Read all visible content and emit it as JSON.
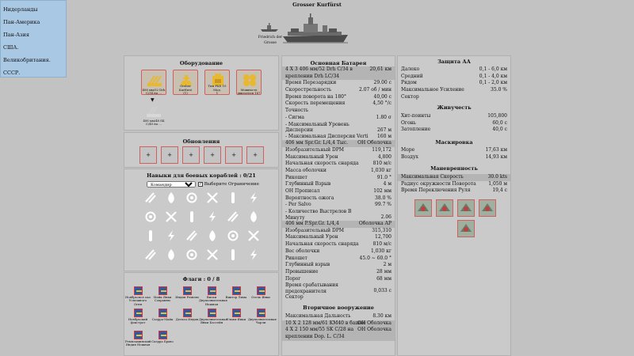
{
  "nav": [
    "Нидерланды",
    "Пан-Америка",
    "Пан-Азия",
    "США.",
    "Великобритания.",
    "СССР."
  ],
  "ship": {
    "title": "Grosser Kurfürst",
    "small_line1": "Friedrich der",
    "small_line2": "Grosse"
  },
  "equipment": {
    "title": "Оборудование",
    "items": [
      {
        "label1": "406 мм/52 Drh",
        "label2": "C/34 на ...",
        "icon": "turret-icon"
      },
      {
        "label1": "Grober Kurfürst",
        "label2": "(1)",
        "icon": "hull-icon"
      },
      {
        "label1": "Тип FKS 10 Мод.",
        "label2": "1",
        "icon": "fire-control-icon"
      },
      {
        "label1": "Мощность",
        "label2": "двигателя 167",
        "icon": "engine-icon"
      }
    ],
    "arrow": "▼",
    "secondary": {
      "label1": "406 мм/48 SK",
      "label2": "C/40 на ..."
    }
  },
  "upgrades": {
    "title": "Обновления",
    "slots": [
      "+",
      "+",
      "+",
      "+",
      "+",
      "+"
    ]
  },
  "skills": {
    "title": "Навыки для боевых кораблей : 0/21",
    "commander": "Командир",
    "checkbox_label": "Выберите Ограничение",
    "checked": true,
    "icons": [
      [
        "guns-icon",
        "flame-icon",
        "flame-icon",
        "wrench-icon",
        "torpedo-icon",
        "lightning-icon"
      ],
      [
        "fire-icon",
        "spotting-icon",
        "fire-drop-icon",
        "crossed-wrenches-icon",
        "telescope-icon",
        "shell-icon"
      ],
      [
        "crossed-guns-icon",
        "explosion-icon",
        "target-icon",
        "cross-icon",
        "wrench-icon",
        "anchor-icon"
      ],
      [
        "spanner-icon",
        "eye-icon",
        "propeller-icon",
        "repair-icon",
        "tower-icon",
        "hammer-icon"
      ]
    ]
  },
  "flags": {
    "title": "Флаги : 0 / 8",
    "items": [
      "Ноябрьское око Успешного Огня",
      "Майк Янки Сохраняю",
      "Индия Ремпли",
      "Виски Двуполнительная Нежная",
      "Виктор Лима",
      "Отель Янки",
      "Ноябрьский фокстрот",
      "Сьерра-Майк",
      "Дельта Индия",
      "Двуполнительная Янки Бассейн",
      "Ульям-Янки",
      "Двуполнительная Чарли",
      "Ремпламинский Индия Нежная",
      "Сьерра Браво"
    ]
  },
  "main_battery": {
    "title": "Основная Батарея",
    "rows": [
      {
        "k": "4 X 3 406 мм/52 Drh C/34 в",
        "v": "20,61 км",
        "sh": true
      },
      {
        "k": "креплении Drh LC/34",
        "v": "",
        "sh": true
      },
      {
        "k": "Время Перезарядки",
        "v": "29.00 с"
      },
      {
        "k": "Скорострельность",
        "v": "2.07 об / мин"
      },
      {
        "k": "Время поворота на 180°",
        "v": "40,00 с"
      },
      {
        "k": "Скорость перемещения",
        "v": "4,50 °/с"
      },
      {
        "k": "Точность",
        "v": ""
      },
      {
        "k": " - Сигма",
        "v": "1.80 σ"
      },
      {
        "k": " - Максимальный Уровень Дисперсии",
        "v": "267 м",
        "tall": true
      },
      {
        "k": " - Максимальная Дисперсия Verti",
        "v": "160 м"
      },
      {
        "k": "406 мм Spr.Gr. L/4,4 Тыс.",
        "v": "ОН Оболочка",
        "sh": true
      },
      {
        "k": "Изобразительный DPM",
        "v": "119,172"
      },
      {
        "k": "Максимальный Урон",
        "v": "4,800"
      },
      {
        "k": "Начальная скорость снаряда",
        "v": "810 м/с"
      },
      {
        "k": "Масса оболочки",
        "v": "1,030 кг"
      },
      {
        "k": "Рикошет",
        "v": "91.0 °"
      },
      {
        "k": "Глубинный Взрыв",
        "v": "4 м"
      },
      {
        "k": "ОН Прописал",
        "v": "102 мм"
      },
      {
        "k": "Вероятность ожога",
        "v": "38.0 %"
      },
      {
        "k": " - Per Salvo",
        "v": "99.7 %"
      },
      {
        "k": " - Количество Выстрелов В Минуту",
        "v": "2.06",
        "tall": true
      },
      {
        "k": "406 мм P.Spr.Gr. L/4,4",
        "v": "Оболочка AP",
        "sh": true
      },
      {
        "k": "Изобразительный DPM",
        "v": "315,310"
      },
      {
        "k": "Максимальный Урон",
        "v": "12,700"
      },
      {
        "k": "Начальная скорость снаряда",
        "v": "810 м/с"
      },
      {
        "k": "Вес оболочки",
        "v": "1,030 кг"
      },
      {
        "k": "Рикошет",
        "v": "45.0 ~ 60.0 °"
      },
      {
        "k": "Глубинный взрыв",
        "v": "2 м"
      },
      {
        "k": "Превышение",
        "v": "28 мм"
      },
      {
        "k": "Порог",
        "v": "68 мм"
      },
      {
        "k": "Время срабатывания предохранителя",
        "v": "0,033 с",
        "tall": true
      },
      {
        "k": "Сектор",
        "v": ""
      }
    ]
  },
  "secondary": {
    "title": "Вторичное вооружение",
    "rows": [
      {
        "k": "Максимальная Дальность",
        "v": "8.30 км"
      },
      {
        "k": "10 X 2 128 мм/61 KM40 в башне",
        "v": "ОН Оболочка",
        "sh": true
      },
      {
        "k": "4 X 2 150 мм/55 SK C/28 на",
        "v": "ОН Оболочка",
        "sh": true
      },
      {
        "k": "креплении Dop. L. C/34",
        "v": "",
        "sh": true
      }
    ]
  },
  "aa": {
    "title": "Защита АА",
    "rows": [
      {
        "k": "Далеко",
        "v": "0,1 - 6,0 км"
      },
      {
        "k": "Средний",
        "v": "0,1 - 4,0 км"
      },
      {
        "k": "Рядом",
        "v": "0,1 - 2,0 км"
      },
      {
        "k": "Максимальное Усиление",
        "v": "35.0 %"
      },
      {
        "k": "Сектор",
        "v": ""
      }
    ]
  },
  "survival": {
    "title": "Живучесть",
    "rows": [
      {
        "k": "Хит-поинты",
        "v": "105,800"
      },
      {
        "k": "Огонь",
        "v": "60,0 с"
      },
      {
        "k": "Затопление",
        "v": "40,0 с"
      }
    ]
  },
  "conceal": {
    "title": "Маскировка",
    "rows": [
      {
        "k": "Море",
        "v": "17,63 км"
      },
      {
        "k": "Воздух",
        "v": "14,93 км"
      }
    ]
  },
  "maneuver": {
    "title": "Маневренность",
    "rows": [
      {
        "k": "Максимальная Скорость",
        "v": "30.0 kts",
        "sh": true
      },
      {
        "k": "Радиус окружности Поворота",
        "v": "1,050 м"
      },
      {
        "k": "Время Переключения Руля",
        "v": "19,4 с"
      }
    ],
    "consumables": [
      "damage-control-icon",
      "repair-party-icon",
      "spotter-plane-icon",
      "fighter-icon",
      "catapult-plane-icon"
    ]
  }
}
